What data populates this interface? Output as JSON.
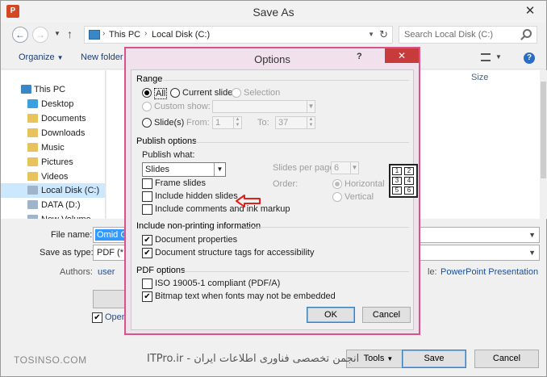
{
  "window": {
    "title": "Save As",
    "app_icon": "P",
    "close": "✕"
  },
  "nav": {
    "breadcrumb": [
      "This PC",
      "Local Disk (C:)"
    ],
    "search_placeholder": "Search Local Disk (C:)"
  },
  "commands": {
    "organize": "Organize",
    "new_folder": "New folder"
  },
  "sidebar": {
    "items": [
      {
        "label": "This PC",
        "icon": "computer-icon"
      },
      {
        "label": "Desktop",
        "icon": "folder-icon"
      },
      {
        "label": "Documents",
        "icon": "folder-icon"
      },
      {
        "label": "Downloads",
        "icon": "folder-icon"
      },
      {
        "label": "Music",
        "icon": "folder-icon"
      },
      {
        "label": "Pictures",
        "icon": "folder-icon"
      },
      {
        "label": "Videos",
        "icon": "folder-icon"
      },
      {
        "label": "Local Disk (C:)",
        "icon": "drive-icon",
        "selected": true
      },
      {
        "label": "DATA (D:)",
        "icon": "drive-icon"
      },
      {
        "label": "New Volume (E:)",
        "icon": "drive-icon"
      }
    ]
  },
  "filelist": {
    "size_column": "Size"
  },
  "form": {
    "file_name_label": "File name:",
    "file_name_value": "Omid Gh",
    "save_as_type_label": "Save as type:",
    "save_as_type_value": "PDF (*.pdf)",
    "authors_label": "Authors:",
    "authors_value": "user",
    "title_label_partial": "le:",
    "title_value": "PowerPoint Presentation",
    "open_file_partial": "Open f"
  },
  "buttons": {
    "tools": "Tools",
    "save": "Save",
    "cancel": "Cancel"
  },
  "watermark": {
    "left": "TOSINSO.COM",
    "right": "انجمن تخصصی فناوری اطلاعات ایران - ITPro.ir"
  },
  "dialog": {
    "title": "Options",
    "help": "?",
    "close": "✕",
    "range": {
      "label": "Range",
      "all": "All",
      "current_slide": "Current slide",
      "selection": "Selection",
      "custom_show": "Custom show:",
      "slides": "Slide(s)",
      "from_label": "From:",
      "from_value": "1",
      "to_label": "To:",
      "to_value": "37",
      "selected": "all"
    },
    "publish": {
      "label": "Publish options",
      "publish_what": "Publish what:",
      "publish_value": "Slides",
      "slides_per_page": "Slides per page:",
      "slides_per_page_value": "6",
      "order": "Order:",
      "horizontal": "Horizontal",
      "vertical": "Vertical",
      "frame_slides": "Frame slides",
      "include_hidden": "Include hidden slides",
      "include_comments": "Include comments and ink markup",
      "grid": [
        "1",
        "2",
        "3",
        "4",
        "5",
        "6"
      ]
    },
    "nonprint": {
      "label": "Include non-printing information",
      "doc_props": "Document properties",
      "doc_tags": "Document structure tags for accessibility"
    },
    "pdf": {
      "label": "PDF options",
      "iso": "ISO 19005-1 compliant (PDF/A)",
      "bitmap": "Bitmap text when fonts may not be embedded"
    },
    "ok": "OK",
    "cancel": "Cancel"
  },
  "colors": {
    "dialog_border": "#d7548a",
    "close_red": "#c73b3b",
    "annotation_arrow": "#e0201b",
    "link": "#1c4e9a"
  }
}
